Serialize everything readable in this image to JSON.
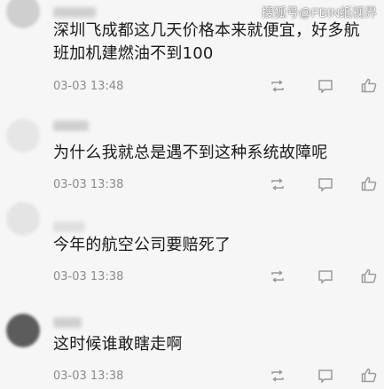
{
  "watermark": "搜狐号@FBIN纸视界",
  "comments": [
    {
      "text": "深圳飞成都这几天价格本来就便宜，好多航班加机建燃油不到100",
      "time": "03-03 13:48"
    },
    {
      "text": "为什么我就总是遇不到这种系统故障呢",
      "time": "03-03 13:38"
    },
    {
      "text": "今年的航空公司要赔死了",
      "time": "03-03 13:38"
    },
    {
      "text": "这时候谁敢瞎走啊",
      "time": "03-03 13:38"
    }
  ],
  "icons": {
    "share": "share-icon",
    "comment": "comment-icon",
    "like": "thumbs-up-icon"
  }
}
